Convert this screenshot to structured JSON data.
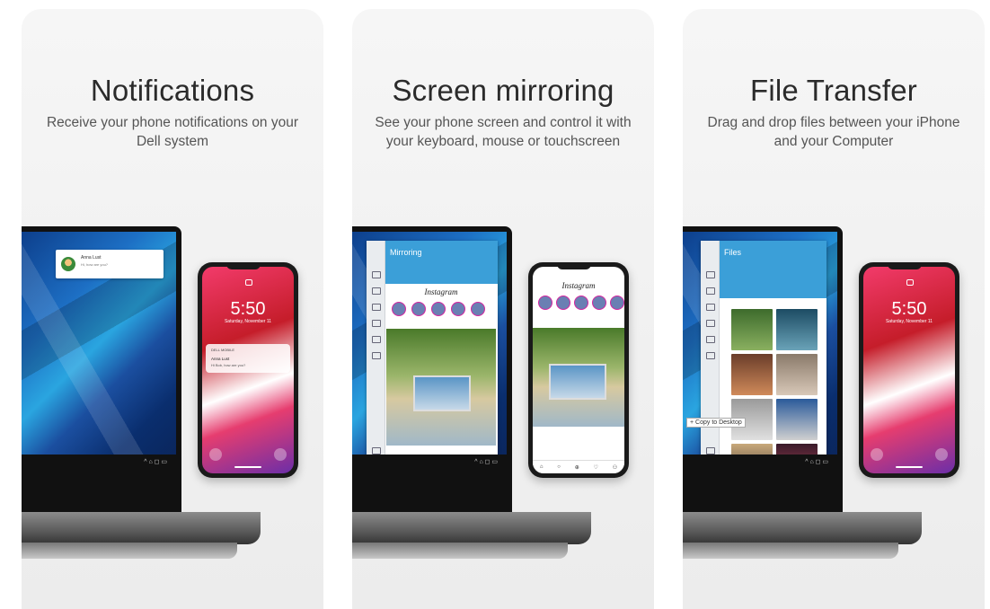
{
  "panels": [
    {
      "title": "Notifications",
      "subtitle": "Receive your phone notifications on your Dell system",
      "laptop_notification": {
        "name": "Anna Lust",
        "message": "Hi, how are you?"
      },
      "phone": {
        "time": "5:50",
        "date": "Saturday, November 11",
        "notification_app": "DELL MOBILE",
        "notification_name": "Anna Lust",
        "notification_message": "Hi Bob, how are you?"
      }
    },
    {
      "title": "Screen mirroring",
      "subtitle": "See your phone screen and control it with your keyboard, mouse or touchscreen",
      "app_title": "Mirroring",
      "phone_app": "Instagram"
    },
    {
      "title": "File Transfer",
      "subtitle": "Drag and drop files between your iPhone and your Computer",
      "app_title": "Files",
      "tooltip": "+ Copy to Desktop",
      "phone": {
        "time": "5:50",
        "date": "Saturday, November 11"
      }
    }
  ],
  "colors": {
    "app_accent": "#3b9fd8",
    "panel_bg": "#f2f2f2"
  }
}
